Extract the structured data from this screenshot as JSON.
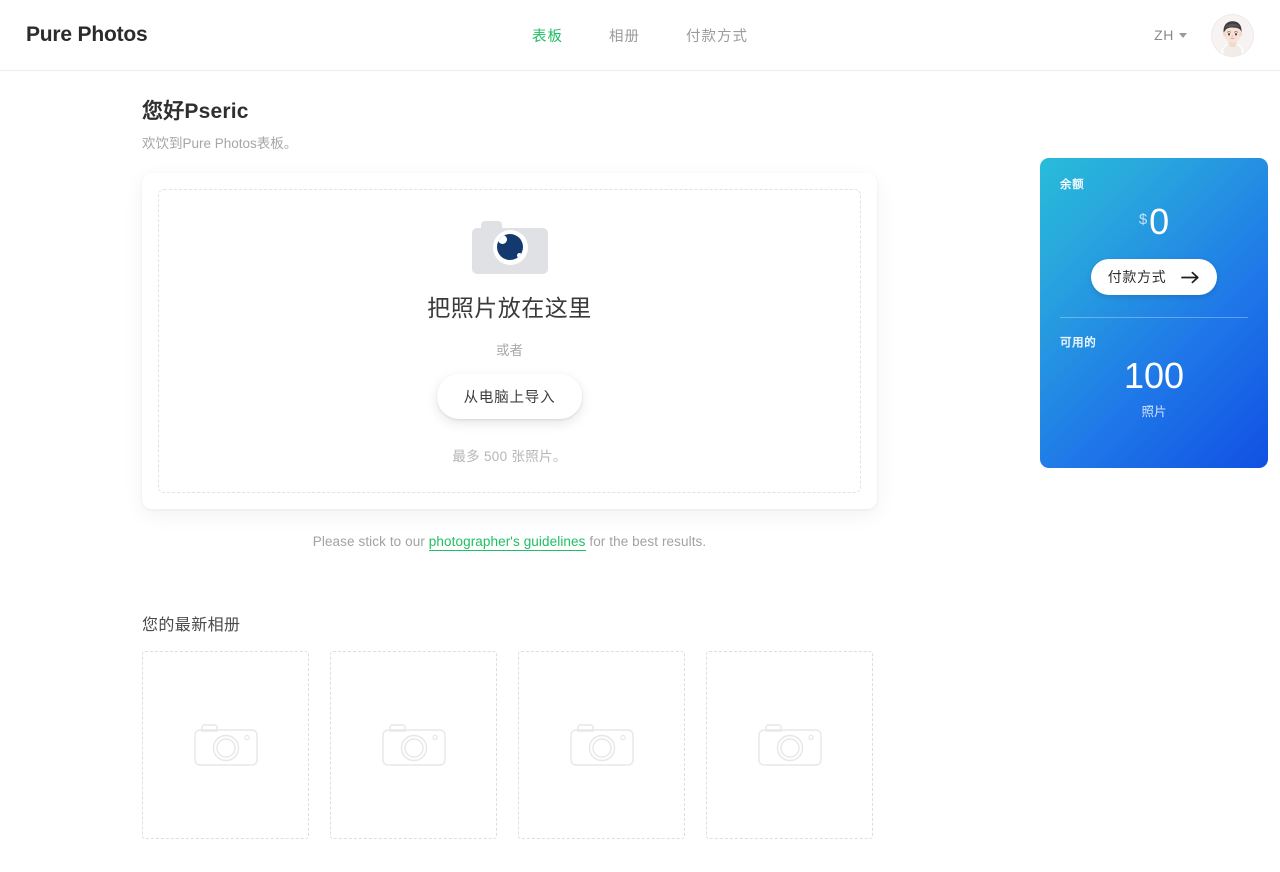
{
  "header": {
    "brand": "Pure Photos",
    "nav": [
      {
        "label": "表板",
        "active": true
      },
      {
        "label": "相册",
        "active": false
      },
      {
        "label": "付款方式",
        "active": false
      }
    ],
    "language": "ZH",
    "avatar_alt": "user-avatar"
  },
  "greeting": {
    "title": "您好Pseric",
    "subtitle": "欢饮到Pure Photos表板。"
  },
  "dropzone": {
    "icon": "camera-icon",
    "title": "把照片放在这里",
    "or": "或者",
    "button": "从电脑上导入",
    "hint": "最多 500 张照片。"
  },
  "guidelines": {
    "prefix": "Please stick to our ",
    "link": "photographer's guidelines",
    "suffix": " for the best results."
  },
  "albums": {
    "title": "您的最新相册",
    "placeholders": [
      {
        "icon": "camera-outline-icon"
      },
      {
        "icon": "camera-outline-icon"
      },
      {
        "icon": "camera-outline-icon"
      },
      {
        "icon": "camera-outline-icon"
      }
    ]
  },
  "balance_card": {
    "balance_label": "余额",
    "currency": "$",
    "balance_value": "0",
    "payment_button": "付款方式",
    "payment_button_icon": "arrow-right-icon",
    "available_label": "可用的",
    "available_value": "100",
    "available_unit": "照片"
  },
  "colors": {
    "accent_green": "#1dbf63",
    "card_gradient_start": "#27bcd9",
    "card_gradient_end": "#1150e3",
    "lens_navy": "#14396f",
    "text_muted": "#a6a6a6"
  }
}
